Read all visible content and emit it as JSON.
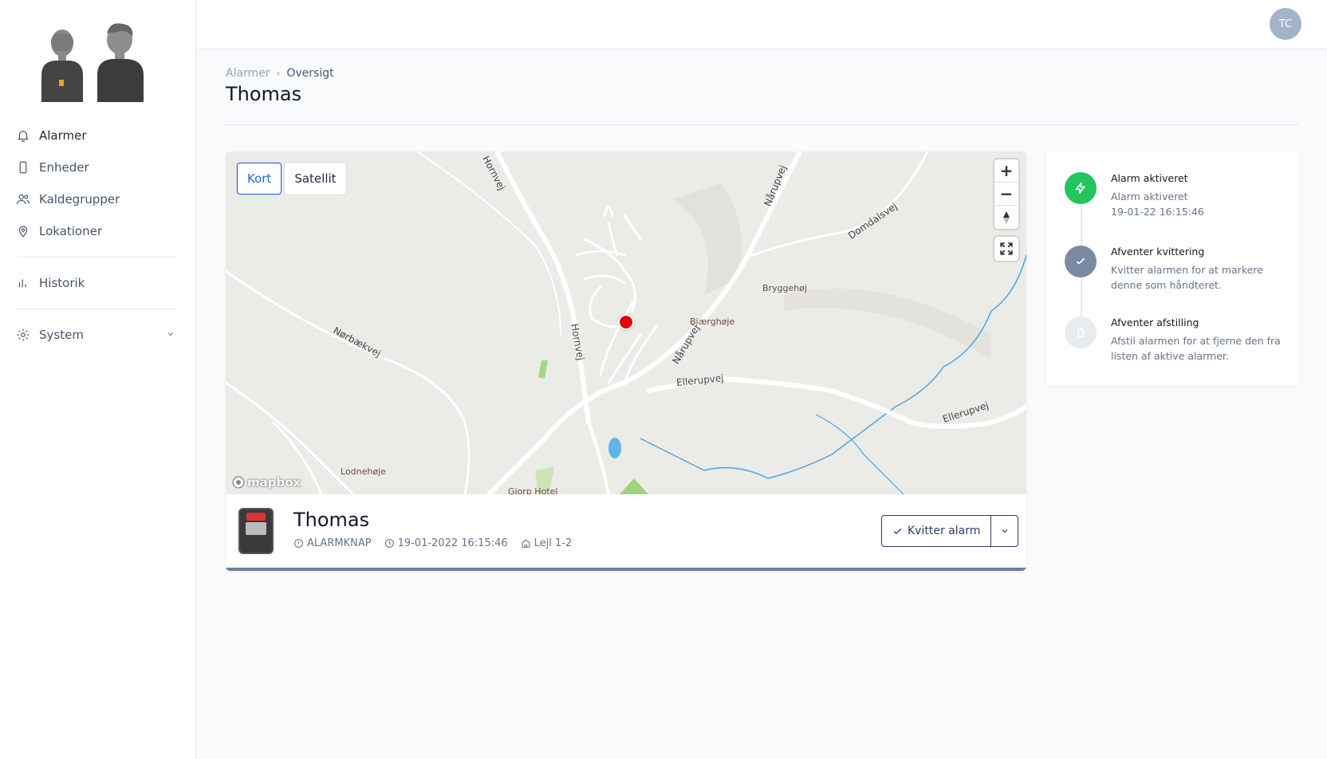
{
  "sidebar": {
    "items": [
      {
        "label": "Alarmer",
        "icon": "bell-icon"
      },
      {
        "label": "Enheder",
        "icon": "device-icon"
      },
      {
        "label": "Kaldegrupper",
        "icon": "users-icon"
      },
      {
        "label": "Lokationer",
        "icon": "location-pin-icon"
      },
      {
        "label": "Historik",
        "icon": "bar-chart-icon"
      },
      {
        "label": "System",
        "icon": "gear-icon"
      }
    ]
  },
  "topbar": {
    "user_initials": "TC"
  },
  "breadcrumb": {
    "root": "Alarmer",
    "current": "Oversigt"
  },
  "page_title": "Thomas",
  "map": {
    "toggle": {
      "map_label": "Kort",
      "satellite_label": "Satellit"
    },
    "attribution": "mapbox",
    "labels": {
      "hornvej_1": "Hornvej",
      "hornvej_2": "Hornvej",
      "narupvej_1": "Nårupvej",
      "narupvej_2": "Nårupvej",
      "domdalsvej": "Domdalsvej",
      "norbaekvej": "Nørbækvej",
      "ellerupvej_1": "Ellerupvej",
      "ellerupvej_2": "Ellerupvej",
      "bryggehoj": "Bryggehøj",
      "bjaerghoje": "Bjærghøje",
      "lodnehoje": "Lodnehøje",
      "gjorp_hotel": "Gjorp Hotel"
    }
  },
  "alarm": {
    "name": "Thomas",
    "type": "ALARMKNAP",
    "time": "19-01-2022 16:15:46",
    "location": "Lejl 1-2",
    "ack_button": "Kvitter alarm"
  },
  "timeline": [
    {
      "title": "Alarm aktiveret",
      "desc": "Alarm aktiveret",
      "time": "19-01-22 16:15:46",
      "color": "#22c55e",
      "icon": "lightning-icon"
    },
    {
      "title": "Afventer kvittering",
      "desc": "Kvitter alarmen for at markere denne som håndteret.",
      "color": "#7a8aa5",
      "icon": "check-icon"
    },
    {
      "title": "Afventer afstilling",
      "desc": "Afstil alarmen for at fjerne den fra listen af aktive alarmer.",
      "color": "#e8ecf1",
      "icon": "trash-icon"
    }
  ]
}
